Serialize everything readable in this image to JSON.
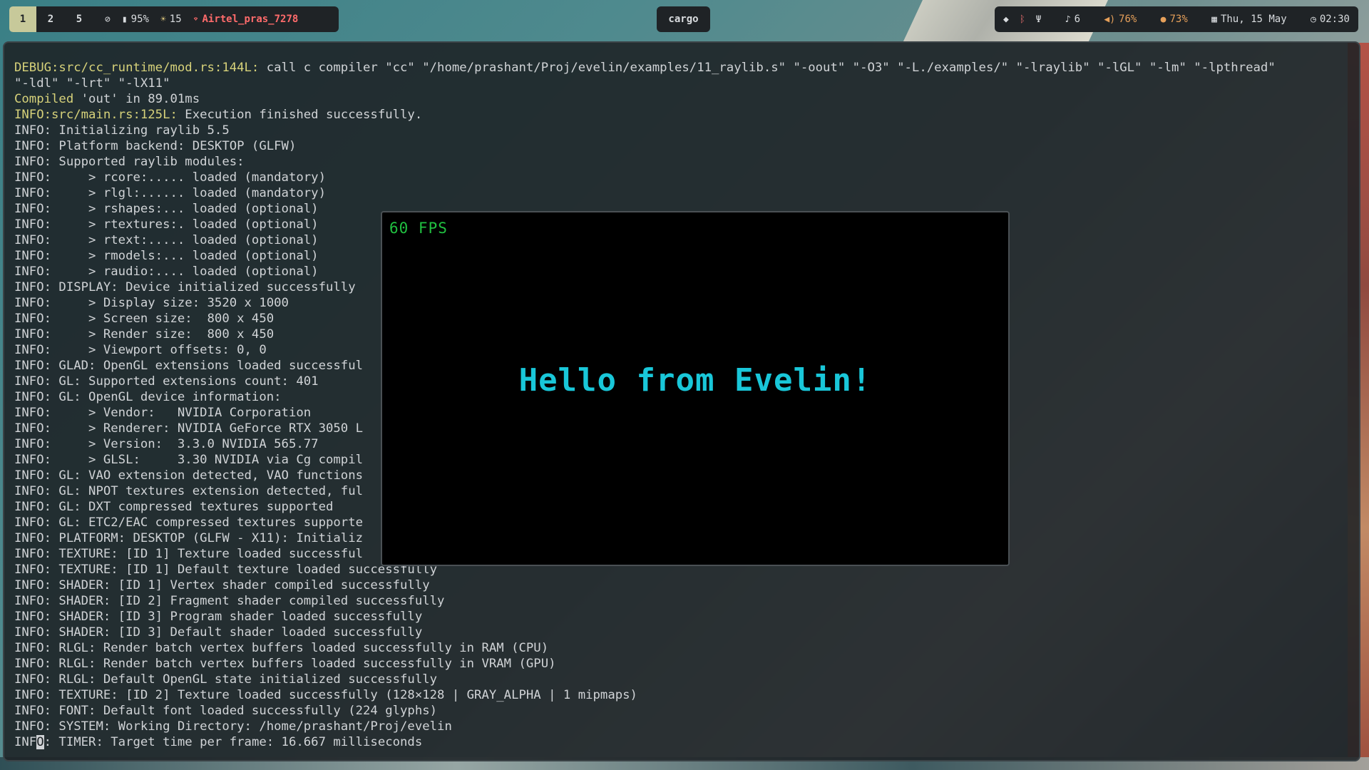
{
  "topbar": {
    "workspaces": [
      "1",
      "2",
      "5"
    ],
    "active_workspace": "1",
    "status_left": {
      "battery": "95%",
      "brightness": "15",
      "wifi_name": "Airtel_pras_7278"
    },
    "active_window_title": "cargo",
    "status_right": {
      "notifications": "6",
      "volume": "76%",
      "mic": "73%",
      "date": "Thu, 15 May",
      "time": "02:30"
    },
    "icons": [
      "eye-off-icon",
      "battery-icon",
      "brightness-icon",
      "wifi-icon",
      "shield-icon",
      "bluetooth-icon",
      "usb-icon",
      "bell-icon",
      "volume-icon",
      "mic-icon",
      "calendar-icon",
      "clock-icon"
    ]
  },
  "terminal": {
    "lines": [
      {
        "prefix": "DEBUG:src/cc_runtime/mod.rs:144L:",
        "text": " call c compiler \"cc\" \"/home/prashant/Proj/evelin/examples/11_raylib.s\" \"-oout\" \"-O3\" \"-L./examples/\" \"-lraylib\" \"-lGL\" \"-lm\" \"-lpthread\""
      },
      {
        "prefix": "",
        "text": "\"-ldl\" \"-lrt\" \"-lX11\""
      },
      {
        "prefix": "Compiled",
        "text": " 'out' in 89.01ms"
      },
      {
        "prefix": "INFO:src/main.rs:125L:",
        "text": " Execution finished successfully."
      },
      {
        "prefix": "",
        "text": "INFO: Initializing raylib 5.5"
      },
      {
        "prefix": "",
        "text": "INFO: Platform backend: DESKTOP (GLFW)"
      },
      {
        "prefix": "",
        "text": "INFO: Supported raylib modules:"
      },
      {
        "prefix": "",
        "text": "INFO:     > rcore:..... loaded (mandatory)"
      },
      {
        "prefix": "",
        "text": "INFO:     > rlgl:...... loaded (mandatory)"
      },
      {
        "prefix": "",
        "text": "INFO:     > rshapes:... loaded (optional)"
      },
      {
        "prefix": "",
        "text": "INFO:     > rtextures:. loaded (optional)"
      },
      {
        "prefix": "",
        "text": "INFO:     > rtext:..... loaded (optional)"
      },
      {
        "prefix": "",
        "text": "INFO:     > rmodels:... loaded (optional)"
      },
      {
        "prefix": "",
        "text": "INFO:     > raudio:.... loaded (optional)"
      },
      {
        "prefix": "",
        "text": "INFO: DISPLAY: Device initialized successfully"
      },
      {
        "prefix": "",
        "text": "INFO:     > Display size: 3520 x 1000"
      },
      {
        "prefix": "",
        "text": "INFO:     > Screen size:  800 x 450"
      },
      {
        "prefix": "",
        "text": "INFO:     > Render size:  800 x 450"
      },
      {
        "prefix": "",
        "text": "INFO:     > Viewport offsets: 0, 0"
      },
      {
        "prefix": "",
        "text": "INFO: GLAD: OpenGL extensions loaded successful"
      },
      {
        "prefix": "",
        "text": "INFO: GL: Supported extensions count: 401"
      },
      {
        "prefix": "",
        "text": "INFO: GL: OpenGL device information:"
      },
      {
        "prefix": "",
        "text": "INFO:     > Vendor:   NVIDIA Corporation"
      },
      {
        "prefix": "",
        "text": "INFO:     > Renderer: NVIDIA GeForce RTX 3050 L"
      },
      {
        "prefix": "",
        "text": "INFO:     > Version:  3.3.0 NVIDIA 565.77"
      },
      {
        "prefix": "",
        "text": "INFO:     > GLSL:     3.30 NVIDIA via Cg compil"
      },
      {
        "prefix": "",
        "text": "INFO: GL: VAO extension detected, VAO functions"
      },
      {
        "prefix": "",
        "text": "INFO: GL: NPOT textures extension detected, ful"
      },
      {
        "prefix": "",
        "text": "INFO: GL: DXT compressed textures supported"
      },
      {
        "prefix": "",
        "text": "INFO: GL: ETC2/EAC compressed textures supporte"
      },
      {
        "prefix": "",
        "text": "INFO: PLATFORM: DESKTOP (GLFW - X11): Initializ"
      },
      {
        "prefix": "",
        "text": "INFO: TEXTURE: [ID 1] Texture loaded successful"
      },
      {
        "prefix": "",
        "text": "INFO: TEXTURE: [ID 1] Default texture loaded successfully"
      },
      {
        "prefix": "",
        "text": "INFO: SHADER: [ID 1] Vertex shader compiled successfully"
      },
      {
        "prefix": "",
        "text": "INFO: SHADER: [ID 2] Fragment shader compiled successfully"
      },
      {
        "prefix": "",
        "text": "INFO: SHADER: [ID 3] Program shader loaded successfully"
      },
      {
        "prefix": "",
        "text": "INFO: SHADER: [ID 3] Default shader loaded successfully"
      },
      {
        "prefix": "",
        "text": "INFO: RLGL: Render batch vertex buffers loaded successfully in RAM (CPU)"
      },
      {
        "prefix": "",
        "text": "INFO: RLGL: Render batch vertex buffers loaded successfully in VRAM (GPU)"
      },
      {
        "prefix": "",
        "text": "INFO: RLGL: Default OpenGL state initialized successfully"
      },
      {
        "prefix": "",
        "text": "INFO: TEXTURE: [ID 2] Texture loaded successfully (128×128 | GRAY_ALPHA | 1 mipmaps)"
      },
      {
        "prefix": "",
        "text": "INFO: FONT: Default font loaded successfully (224 glyphs)"
      },
      {
        "prefix": "",
        "text": "INFO: SYSTEM: Working Directory: /home/prashant/Proj/evelin"
      }
    ],
    "last_line": {
      "before_cursor": "INF",
      "cursor_char": "O",
      "after_cursor": ": TIMER: Target time per frame: 16.667 milliseconds"
    }
  },
  "game_window": {
    "fps_text": "60 FPS",
    "message": "Hello from Evelin!"
  },
  "colors": {
    "fps": "#20c040",
    "message": "#19c7d9",
    "log_highlight": "#d7d27a",
    "wifi": "#ff6b6b"
  }
}
